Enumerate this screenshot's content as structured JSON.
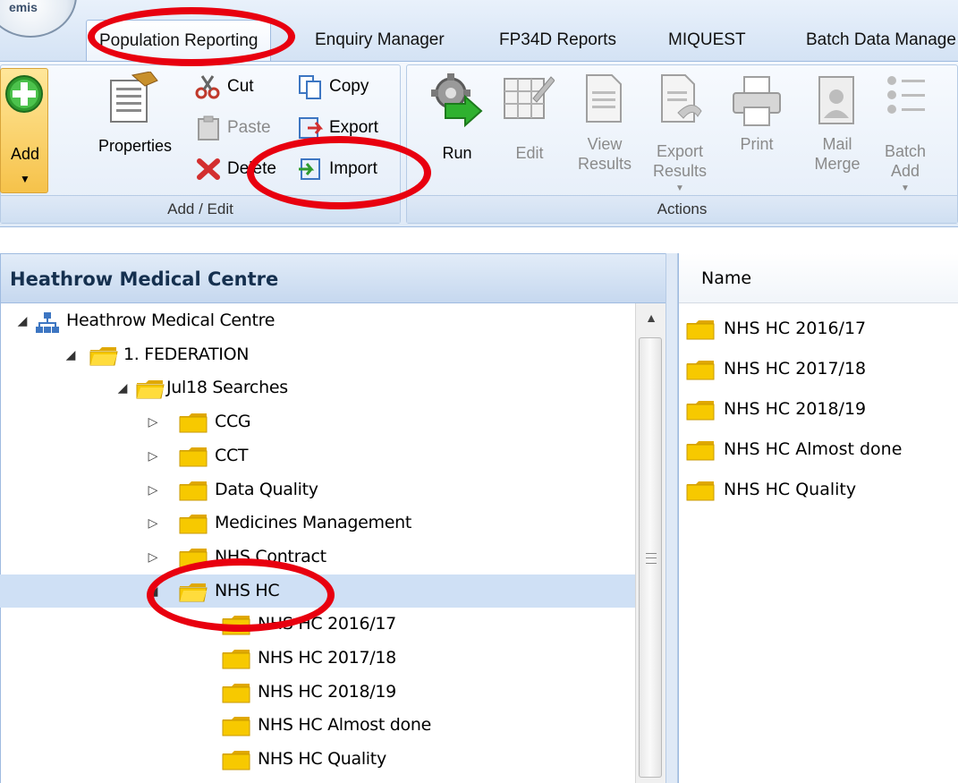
{
  "app": {
    "orb_label": "emis"
  },
  "tabs": [
    {
      "label": "Population Reporting",
      "active": true
    },
    {
      "label": "Enquiry Manager"
    },
    {
      "label": "FP34D Reports"
    },
    {
      "label": "MIQUEST"
    },
    {
      "label": "Batch Data Manage"
    }
  ],
  "ribbon": {
    "add_edit_group": {
      "title": "Add / Edit",
      "add": "Add",
      "properties": "Properties",
      "cut": "Cut",
      "paste": "Paste",
      "delete": "Delete",
      "copy": "Copy",
      "export": "Export",
      "import": "Import"
    },
    "actions_group": {
      "title": "Actions",
      "run": "Run",
      "edit": "Edit",
      "view_results_1": "View",
      "view_results_2": "Results",
      "export_results_1": "Export",
      "export_results_2": "Results",
      "print": "Print",
      "mail_merge_1": "Mail",
      "mail_merge_2": "Merge",
      "batch_add_1": "Batch",
      "batch_add_2": "Add"
    }
  },
  "left_panel": {
    "title": "Heathrow Medical Centre",
    "tree": [
      {
        "label": "Heathrow Medical Centre",
        "expander": "◢",
        "icon": "org"
      },
      {
        "label": "1. FEDERATION",
        "expander": "◢",
        "icon": "folder-open"
      },
      {
        "label": "Jul18 Searches",
        "expander": "◢",
        "icon": "folder-open"
      },
      {
        "label": "CCG",
        "expander": "▷",
        "icon": "folder"
      },
      {
        "label": "CCT",
        "expander": "▷",
        "icon": "folder"
      },
      {
        "label": "Data Quality",
        "expander": "▷",
        "icon": "folder"
      },
      {
        "label": "Medicines Management",
        "expander": "▷",
        "icon": "folder"
      },
      {
        "label": "NHS Contract",
        "expander": "▷",
        "icon": "folder"
      },
      {
        "label": "NHS HC",
        "expander": "◢",
        "icon": "folder-open",
        "selected": true
      },
      {
        "label": "NHS HC 2016/17",
        "expander": "",
        "icon": "folder"
      },
      {
        "label": "NHS HC 2017/18",
        "expander": "",
        "icon": "folder"
      },
      {
        "label": "NHS HC 2018/19",
        "expander": "",
        "icon": "folder"
      },
      {
        "label": "NHS HC Almost done",
        "expander": "",
        "icon": "folder"
      },
      {
        "label": "NHS HC Quality",
        "expander": "",
        "icon": "folder"
      }
    ]
  },
  "right_panel": {
    "column_header": "Name",
    "items": [
      "NHS HC 2016/17",
      "NHS HC 2017/18",
      "NHS HC 2018/19",
      "NHS HC Almost done",
      "NHS HC Quality"
    ]
  },
  "colors": {
    "annotation": "#e8000f",
    "folder": "#f5c400",
    "selection": "#cfe0f5",
    "ribbon_border": "#9fbbe0"
  }
}
